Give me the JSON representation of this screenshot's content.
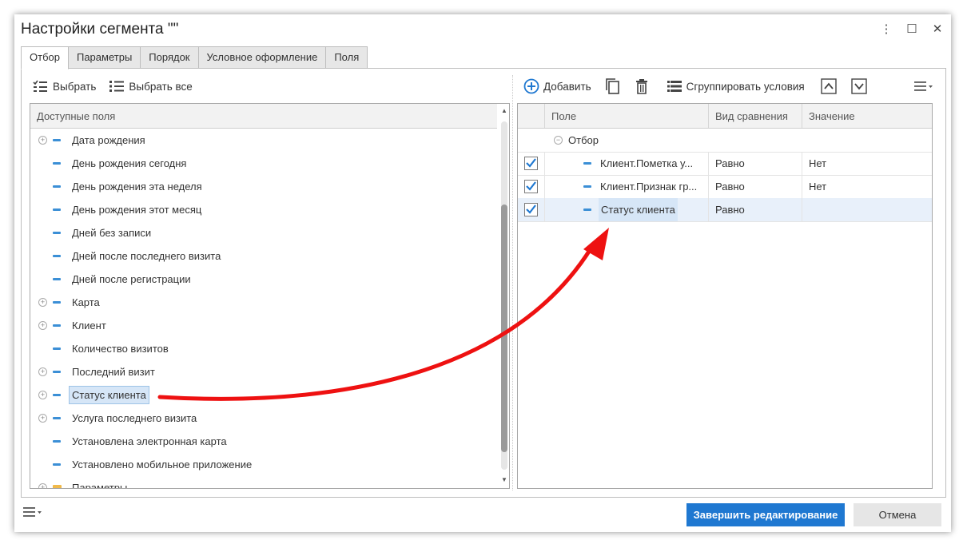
{
  "window": {
    "title": "Настройки сегмента \"\""
  },
  "tabs": [
    "Отбор",
    "Параметры",
    "Порядок",
    "Условное оформление",
    "Поля"
  ],
  "left_toolbar": {
    "select": "Выбрать",
    "select_all": "Выбрать все"
  },
  "available_fields": {
    "header": "Доступные поля",
    "items": [
      {
        "label": "Дата рождения",
        "expandable": true
      },
      {
        "label": "День рождения сегодня",
        "expandable": false
      },
      {
        "label": "День рождения эта неделя",
        "expandable": false
      },
      {
        "label": "День рождения этот месяц",
        "expandable": false
      },
      {
        "label": "Дней без записи",
        "expandable": false
      },
      {
        "label": "Дней после последнего визита",
        "expandable": false
      },
      {
        "label": "Дней после регистрации",
        "expandable": false
      },
      {
        "label": "Карта",
        "expandable": true
      },
      {
        "label": "Клиент",
        "expandable": true
      },
      {
        "label": "Количество визитов",
        "expandable": false
      },
      {
        "label": "Последний визит",
        "expandable": true
      },
      {
        "label": "Статус клиента",
        "expandable": true,
        "selected": true
      },
      {
        "label": "Услуга последнего визита",
        "expandable": true
      },
      {
        "label": "Установлена электронная карта",
        "expandable": false
      },
      {
        "label": "Установлено мобильное приложение",
        "expandable": false
      },
      {
        "label": "Параметры",
        "expandable": true,
        "folder": true
      }
    ]
  },
  "right_toolbar": {
    "add": "Добавить",
    "group": "Сгруппировать условия"
  },
  "filter_grid": {
    "headers": {
      "field": "Поле",
      "comparison": "Вид сравнения",
      "value": "Значение"
    },
    "group_label": "Отбор",
    "rows": [
      {
        "checked": true,
        "field": "Клиент.Пометка у...",
        "comparison": "Равно",
        "value": "Нет"
      },
      {
        "checked": true,
        "field": "Клиент.Признак гр...",
        "comparison": "Равно",
        "value": "Нет"
      },
      {
        "checked": true,
        "field": "Статус клиента",
        "comparison": "Равно",
        "value": ""
      }
    ]
  },
  "footer": {
    "finish": "Завершить редактирование",
    "cancel": "Отмена"
  },
  "colors": {
    "accent": "#1f78d1",
    "selection": "#d6e6f7",
    "arrow": "#ee1111"
  }
}
